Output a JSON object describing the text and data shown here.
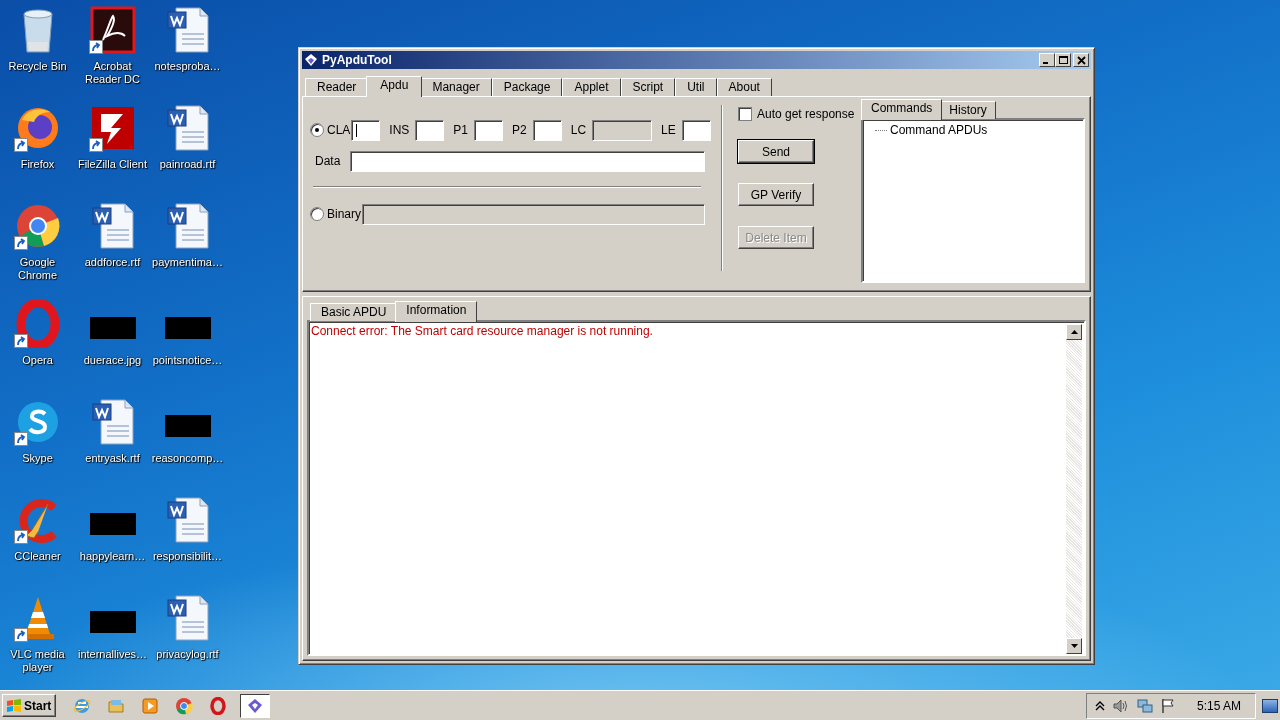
{
  "desktop": {
    "icons": [
      {
        "label": "Recycle Bin",
        "kind": "recycle",
        "shortcut": false
      },
      {
        "label": "Acrobat Reader DC",
        "kind": "acrobat",
        "shortcut": true
      },
      {
        "label": "notesproba…",
        "kind": "word",
        "shortcut": false
      },
      {
        "label": "Firefox",
        "kind": "firefox",
        "shortcut": true
      },
      {
        "label": "FileZilla Client",
        "kind": "filezilla",
        "shortcut": true
      },
      {
        "label": "painroad.rtf",
        "kind": "word",
        "shortcut": false
      },
      {
        "label": "Google Chrome",
        "kind": "chrome",
        "shortcut": true
      },
      {
        "label": "addforce.rtf",
        "kind": "word",
        "shortcut": false
      },
      {
        "label": "paymentima…",
        "kind": "word",
        "shortcut": false
      },
      {
        "label": "Opera",
        "kind": "opera",
        "shortcut": true
      },
      {
        "label": "duerace.jpg",
        "kind": "image",
        "shortcut": false
      },
      {
        "label": "pointsnotice…",
        "kind": "image",
        "shortcut": false
      },
      {
        "label": "Skype",
        "kind": "skype",
        "shortcut": true
      },
      {
        "label": "entryask.rtf",
        "kind": "word",
        "shortcut": false
      },
      {
        "label": "reasoncomp…",
        "kind": "image",
        "shortcut": false
      },
      {
        "label": "CCleaner",
        "kind": "ccleaner",
        "shortcut": true
      },
      {
        "label": "happylearn…",
        "kind": "image",
        "shortcut": false
      },
      {
        "label": "responsibilit…",
        "kind": "word",
        "shortcut": false
      },
      {
        "label": "VLC media player",
        "kind": "vlc",
        "shortcut": true
      },
      {
        "label": "internallives…",
        "kind": "image",
        "shortcut": false
      },
      {
        "label": "privacylog.rtf",
        "kind": "word",
        "shortcut": false
      }
    ]
  },
  "window": {
    "title": "PyApduTool",
    "tabs": [
      {
        "label": "Reader",
        "selected": false
      },
      {
        "label": "Apdu",
        "selected": true
      },
      {
        "label": "Manager",
        "selected": false
      },
      {
        "label": "Package",
        "selected": false
      },
      {
        "label": "Applet",
        "selected": false
      },
      {
        "label": "Script",
        "selected": false
      },
      {
        "label": "Util",
        "selected": false
      },
      {
        "label": "About",
        "selected": false
      }
    ],
    "apdu_radio": {
      "label": "CLA",
      "selected": true
    },
    "cla_field": {
      "focused": true
    },
    "fields": [
      {
        "label": "INS",
        "disabled": false
      },
      {
        "label": "P1",
        "disabled": false
      },
      {
        "label": "P2",
        "disabled": false
      },
      {
        "label": "LC",
        "disabled": true
      },
      {
        "label": "LE",
        "disabled": false
      }
    ],
    "data_field": {
      "label": "Data"
    },
    "binary_radio": {
      "label": "Binary",
      "selected": false
    },
    "auto_get_response": {
      "label": "Auto get response",
      "checked": false
    },
    "buttons": [
      {
        "label": "Send",
        "default": true,
        "disabled": false
      },
      {
        "label": "GP Verify",
        "default": false,
        "disabled": false
      },
      {
        "label": "Delete Item",
        "default": false,
        "disabled": true
      }
    ],
    "side_tabs": [
      {
        "label": "Commands",
        "selected": true
      },
      {
        "label": "History",
        "selected": false
      }
    ],
    "tree": [
      {
        "label": "Command APDUs"
      }
    ],
    "output_tabs": [
      {
        "label": "Basic APDU",
        "selected": false
      },
      {
        "label": "Information",
        "selected": true
      }
    ],
    "log": [
      {
        "text": "Connect error: The Smart card resource manager is not running.",
        "kind": "error"
      }
    ]
  },
  "taskbar": {
    "start": "Start",
    "apps": [
      {
        "kind": "ie",
        "active": false
      },
      {
        "kind": "explorer",
        "active": false
      },
      {
        "kind": "media",
        "active": false
      },
      {
        "kind": "chrome",
        "active": false
      },
      {
        "kind": "opera",
        "active": false
      },
      {
        "kind": "pyapdu",
        "active": true
      }
    ],
    "clock": "5:15 AM"
  }
}
